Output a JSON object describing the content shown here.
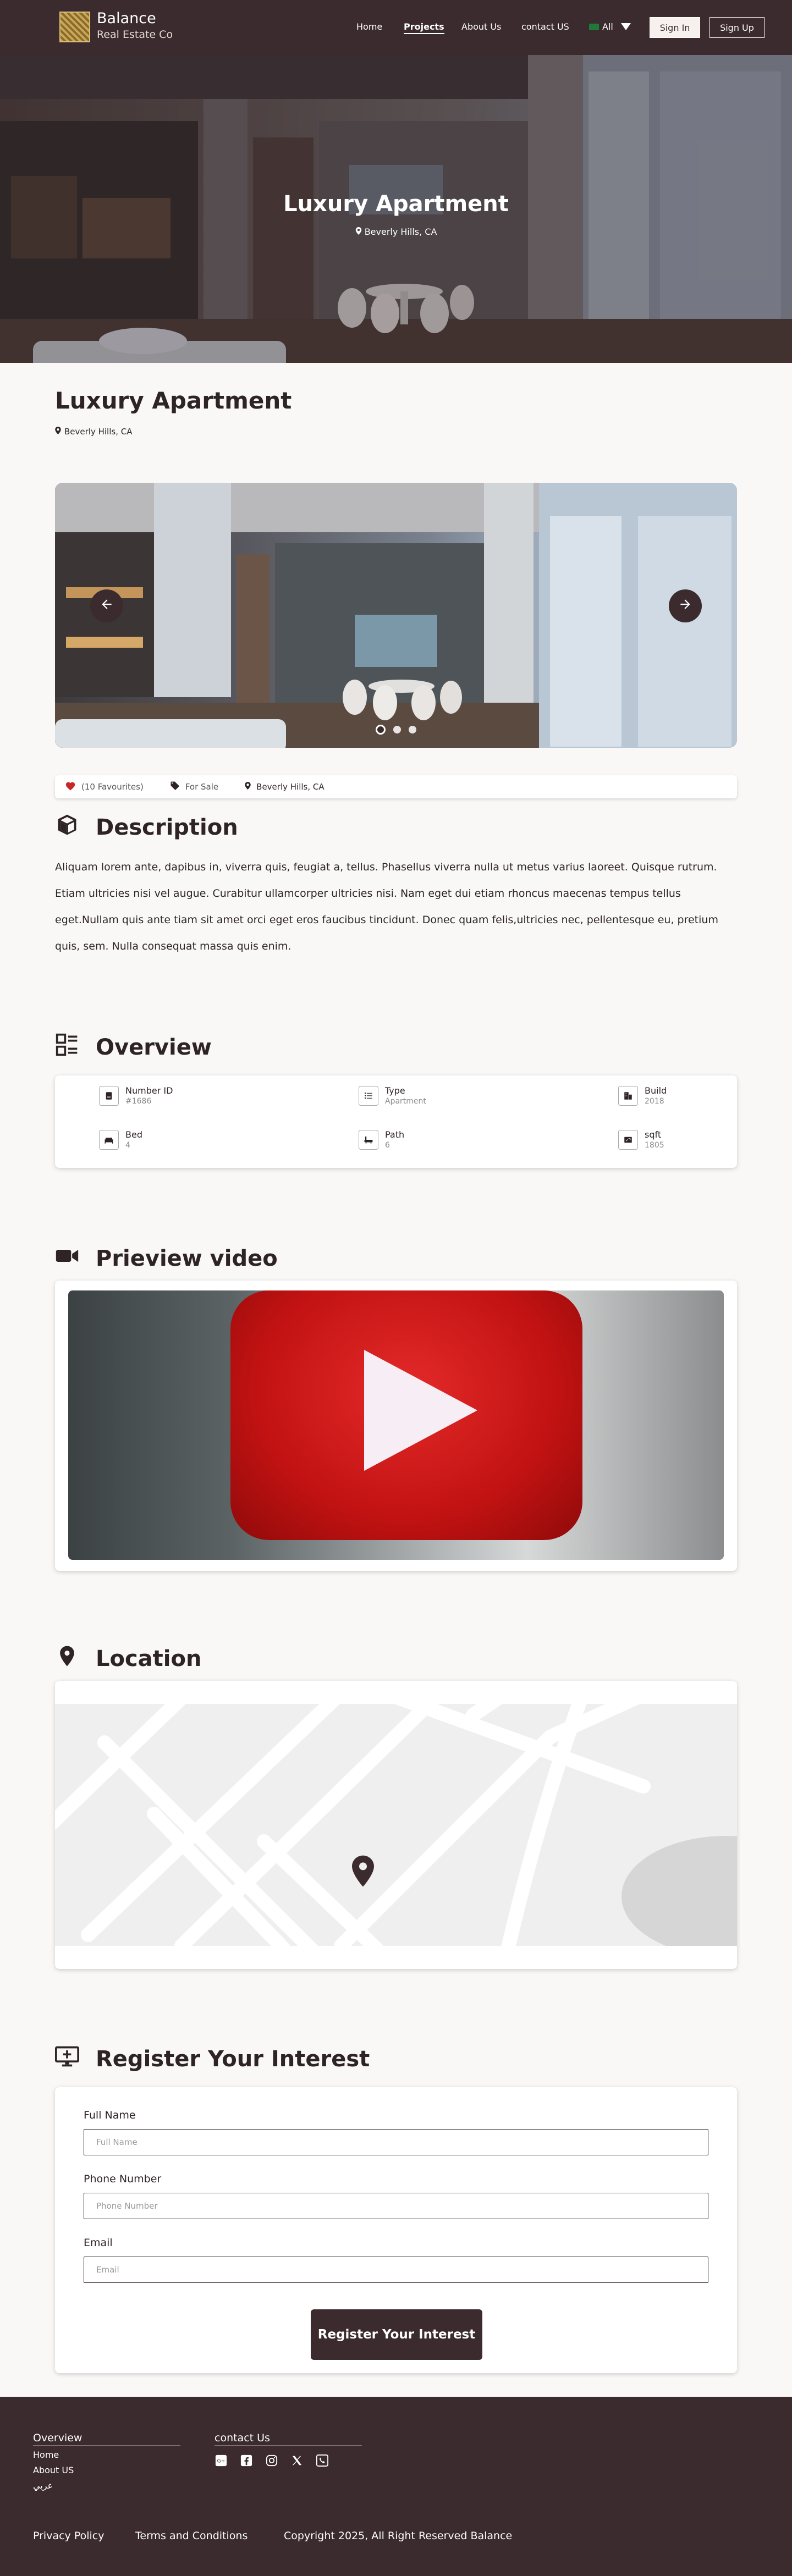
{
  "navbar": {
    "brand_name": "Balance",
    "brand_sub": "Real Estate Co",
    "links": [
      "Home",
      "Projects",
      "About Us",
      "contact US"
    ],
    "lang": "All",
    "signin": "Sign In",
    "signup": "Sign Up"
  },
  "hero": {
    "title": "Luxury Apartment",
    "location": "Beverly Hills, CA"
  },
  "property": {
    "title": "Luxury Apartment",
    "location": "Beverly Hills, CA"
  },
  "meta": {
    "favourites": "(10 Favourites)",
    "status": "For Sale",
    "location": "Beverly Hills, CA"
  },
  "description": {
    "heading": "Description",
    "text": "Aliquam lorem ante, dapibus in, viverra quis, feugiat a, tellus. Phasellus viverra nulla ut metus varius laoreet. Quisque rutrum. Etiam ultricies nisi vel augue. Curabitur ullamcorper ultricies nisi. Nam eget dui etiam rhoncus maecenas tempus tellus eget.Nullam quis ante tiam sit amet orci eget eros faucibus tincidunt. Donec quam felis,ultricies nec, pellentesque eu, pretium quis, sem. Nulla consequat massa quis enim."
  },
  "overview": {
    "heading": "Overview",
    "items": [
      {
        "label": "Number ID",
        "value": "#1686"
      },
      {
        "label": "Type",
        "value": "Apartment"
      },
      {
        "label": "Build",
        "value": "2018"
      },
      {
        "label": "Bed",
        "value": "4"
      },
      {
        "label": "Path",
        "value": "6"
      },
      {
        "label": "sqft",
        "value": "1805"
      }
    ]
  },
  "video": {
    "heading": "Prieview video"
  },
  "location": {
    "heading": "Location"
  },
  "register": {
    "heading": "Register Your Interest",
    "fields": [
      {
        "label": "Full Name",
        "placeholder": "Full Name"
      },
      {
        "label": "Phone Number",
        "placeholder": "Phone Number"
      },
      {
        "label": "Email",
        "placeholder": "Email"
      }
    ],
    "submit": "Register Your Interest"
  },
  "footer": {
    "col1_title": "Overview",
    "col1_links": [
      "Home",
      "About US",
      "عربي"
    ],
    "col2_title": "contact Us",
    "privacy": "Privacy Policy",
    "terms": "Terms and Conditions",
    "copyright": "Copyright 2025, All Right Reserved Balance"
  },
  "colors": {
    "primary": "#3b2b2e",
    "background": "#f9f8f6",
    "accent_red": "#d32f2f"
  }
}
